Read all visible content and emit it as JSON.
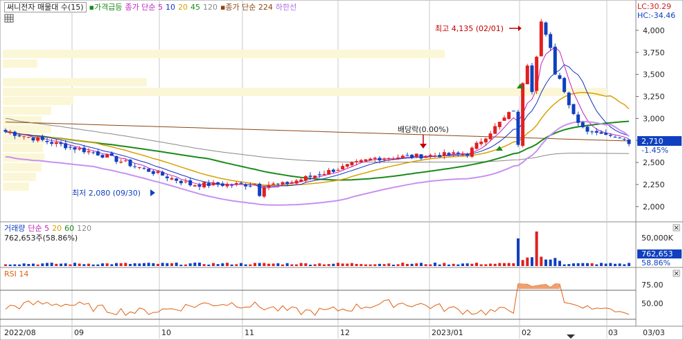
{
  "title": "써니전자 매물대 수(15)",
  "legend_main": [
    {
      "text": "가격급등",
      "color": "#1a8a1a",
      "icon": "square-icon"
    },
    {
      "text": "종가 단순 5",
      "color": "#c020c0"
    },
    {
      "text": "10",
      "color": "#1030c0"
    },
    {
      "text": "20",
      "color": "#d8a000"
    },
    {
      "text": "45",
      "color": "#1a8a1a"
    },
    {
      "text": "120",
      "color": "#888888"
    },
    {
      "text": "종가 단순 224",
      "color": "#8b4513",
      "icon": "square-icon"
    },
    {
      "text": "하한선",
      "color": "#b070e0"
    }
  ],
  "lc_label": "LC:30.29",
  "hc_label": "HC:-34.46",
  "colors": {
    "up": "#e02020",
    "down": "#1040c0",
    "grid": "#c8c8c8",
    "lower_band": "#c890f0",
    "volume_profile": "#fbf7d6",
    "rsi": "#e06010",
    "rsi_fill": "#f0a070"
  },
  "annotations": {
    "high": "최고 4,135 (02/01)",
    "low": "최저 2,080 (09/30)",
    "dividend": "배당락(0.00%)"
  },
  "price_panel": {
    "y_ticks": [
      "4,000",
      "3,750",
      "3,500",
      "3,250",
      "3,000",
      "2,750",
      "2,500",
      "2,250",
      "2,000"
    ],
    "current_price": "2,710",
    "change_pct": "-1.45%"
  },
  "volume_panel": {
    "title": "거래량",
    "ma_legend": [
      {
        "text": "단순 5",
        "color": "#c020c0"
      },
      {
        "text": "20",
        "color": "#d8a000"
      },
      {
        "text": "60",
        "color": "#1a8a1a"
      },
      {
        "text": "120",
        "color": "#888888"
      }
    ],
    "current": "762,653주(58.86%)",
    "y_tick": "50,000K",
    "current_value": "762,653",
    "current_pct": "58.86%"
  },
  "rsi_panel": {
    "title": "RSI 14",
    "y_ticks": [
      "75.00",
      "50.00"
    ]
  },
  "x_labels": [
    "2022/08",
    "09",
    "10",
    "11",
    "12",
    "2023/01",
    "02",
    "03",
    "03/03"
  ],
  "chart_data": {
    "type": "line",
    "title": "써니전자 매물대 수(15)",
    "x": [
      "2022-08",
      "2022-09",
      "2022-10",
      "2022-11",
      "2022-12",
      "2023-01",
      "2023-02",
      "2023-03"
    ],
    "series": [
      {
        "name": "종가",
        "values": [
          2850,
          2600,
          2250,
          2250,
          2550,
          2600,
          3500,
          2710
        ]
      }
    ],
    "ylim": [
      1850,
      4250
    ],
    "high": {
      "value": 4135,
      "date": "02/01"
    },
    "low": {
      "value": 2080,
      "date": "09/30"
    },
    "current": 2710
  }
}
